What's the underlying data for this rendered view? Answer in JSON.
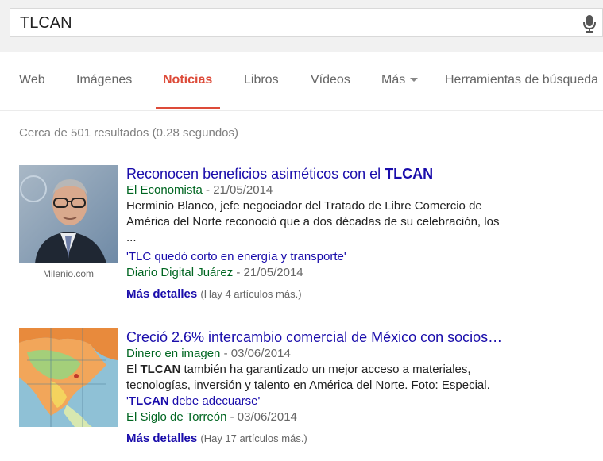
{
  "search": {
    "query": "TLCAN"
  },
  "tabs": [
    {
      "label": "Web"
    },
    {
      "label": "Imágenes"
    },
    {
      "label": "Noticias"
    },
    {
      "label": "Libros"
    },
    {
      "label": "Vídeos"
    },
    {
      "label": "Más"
    },
    {
      "label": "Herramientas de búsqueda"
    }
  ],
  "active_tab": "Noticias",
  "stats": "Cerca de 501 resultados (0.28 segundos)",
  "results": [
    {
      "title_pre": "Reconocen beneficios asiméticos con el ",
      "title_bold": "TLCAN",
      "title_post": "",
      "source": "El Economista",
      "date": " - 21/05/2014",
      "snippet_pre": "",
      "snippet_bold": "",
      "snippet": "Herminio Blanco, jefe negociador del Tratado de Libre Comercio de América del Norte reconoció que a dos décadas de su celebración, los ...",
      "image_caption": "Milenio.com",
      "sublink_pre": "'TLC quedó corto en energía y transporte'",
      "sublink_bold": "",
      "sublink_post": "",
      "sub_source": "Diario Digital Juárez",
      "sub_date": " - 21/05/2014",
      "more_label": "Más detalles",
      "more_count": "(Hay 4 artículos más.)"
    },
    {
      "title_pre": "Creció 2.6% intercambio comercial de México con socios…",
      "title_bold": "",
      "title_post": "",
      "source": "Dinero en imagen",
      "date": " - 03/06/2014",
      "snippet_pre": "El ",
      "snippet_bold": "TLCAN",
      "snippet": " también ha garantizado un mejor acceso a materiales, tecnologías, inversión y talento en América del Norte. Foto: Especial.",
      "image_caption": "",
      "sublink_pre": "'",
      "sublink_bold": "TLCAN",
      "sublink_post": " debe adecuarse'",
      "sub_source": "El Siglo de Torreón",
      "sub_date": " - 03/06/2014",
      "more_label": "Más detalles",
      "more_count": "(Hay 17 artículos más.)"
    }
  ]
}
